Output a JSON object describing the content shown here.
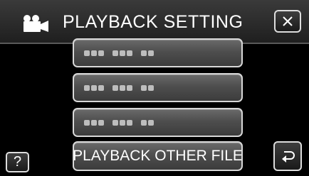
{
  "header": {
    "title": "PLAYBACK SETTING",
    "mode_icon": "movie-camera-icon",
    "close_icon": "close-icon"
  },
  "menu": {
    "items": [
      {
        "label": "",
        "placeholder_icon": "dotted-text-placeholder-icon"
      },
      {
        "label": "",
        "placeholder_icon": "dotted-text-placeholder-icon"
      },
      {
        "label": "",
        "placeholder_icon": "dotted-text-placeholder-icon"
      },
      {
        "label": "PLAYBACK OTHER FILE"
      }
    ]
  },
  "footer": {
    "help_label": "?",
    "back_icon": "return-arrow-icon"
  }
}
